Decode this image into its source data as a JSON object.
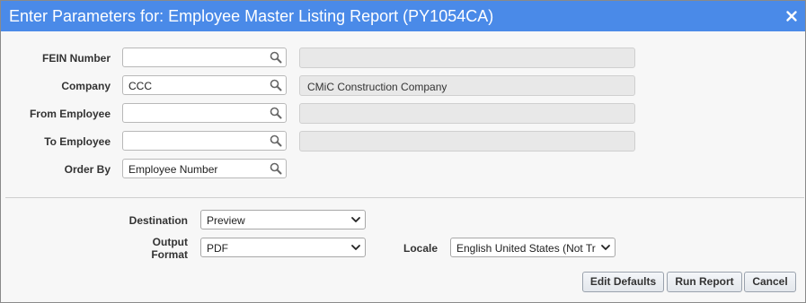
{
  "dialog": {
    "title": "Enter Parameters for: Employee Master Listing Report (PY1054CA)",
    "close_icon": "close-icon"
  },
  "params": [
    {
      "label": "FEIN Number",
      "value": "",
      "description": ""
    },
    {
      "label": "Company",
      "value": "CCC",
      "description": "CMiC Construction Company"
    },
    {
      "label": "From Employee",
      "value": "",
      "description": ""
    },
    {
      "label": "To Employee",
      "value": "",
      "description": ""
    },
    {
      "label": "Order By",
      "value": "Employee Number"
    }
  ],
  "output": {
    "destination_label": "Destination",
    "destination_value": "Preview",
    "format_label_1": "Output",
    "format_label_2": "Format",
    "format_value": "PDF",
    "locale_label": "Locale",
    "locale_value": "English United States (Not Tr"
  },
  "buttons": {
    "edit_defaults": "Edit Defaults",
    "run_report": "Run Report",
    "cancel": "Cancel"
  },
  "colors": {
    "titlebar": "#4a8ae8",
    "panel": "#f7f7f7",
    "readonly_field": "#e8e8e8"
  },
  "icons": [
    "close-icon",
    "search-icon",
    "chevron-down-icon"
  ]
}
